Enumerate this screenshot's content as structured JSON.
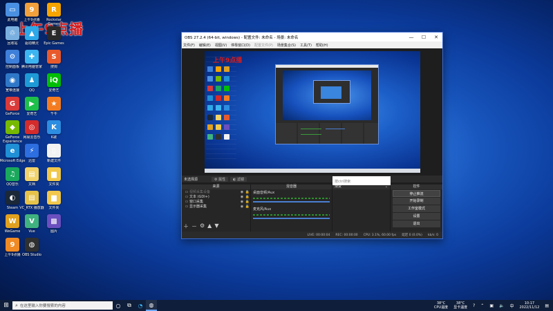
{
  "desktop": {
    "watermark": "上午9点播",
    "icons": [
      {
        "label": "此电脑",
        "color": "#4a90e2",
        "glyph": "▭"
      },
      {
        "label": "回收站",
        "color": "#7ab0e0",
        "glyph": "♲"
      },
      {
        "label": "控制面板",
        "color": "#3d7fd9",
        "glyph": "⚙"
      },
      {
        "label": "宽带连接",
        "color": "#2f78c8",
        "glyph": "◉"
      },
      {
        "label": "GeForce",
        "color": "#d93a3a",
        "glyph": "G"
      },
      {
        "label": "GeForce Experience",
        "color": "#76b900",
        "glyph": "◆"
      },
      {
        "label": "Microsoft Edge",
        "color": "#1f8fd6",
        "glyph": "e"
      },
      {
        "label": "QQ音乐",
        "color": "#19a85c",
        "glyph": "♫"
      },
      {
        "label": "Steam",
        "color": "#1b2838",
        "glyph": "◐"
      },
      {
        "label": "WeGame",
        "color": "#e0a020",
        "glyph": "W"
      },
      {
        "label": "上午9点播",
        "color": "#f08a24",
        "glyph": "9"
      },
      {
        "label": "上午9点播",
        "color": "#f2a03c",
        "glyph": "9"
      },
      {
        "label": "驱动精灵",
        "color": "#2da8e8",
        "glyph": "▲"
      },
      {
        "label": "腾讯电脑管家",
        "color": "#3cb4f0",
        "glyph": "✚"
      },
      {
        "label": "QQ",
        "color": "#1e9ad6",
        "glyph": "♟"
      },
      {
        "label": "爱奇艺",
        "color": "#1ec04a",
        "glyph": "▶"
      },
      {
        "label": "网易云音乐",
        "color": "#d42b2b",
        "glyph": "◎"
      },
      {
        "label": "迅雷",
        "color": "#2d6ee0",
        "glyph": "⚡"
      },
      {
        "label": "文档",
        "color": "#f1d36a",
        "glyph": "▤"
      },
      {
        "label": "VC_RTX 播放器",
        "color": "#e6c24a",
        "glyph": "▤"
      },
      {
        "label": "Vue",
        "color": "#3fb27f",
        "glyph": "V"
      },
      {
        "label": "OBS Studio",
        "color": "#303030",
        "glyph": "◍"
      },
      {
        "label": "Rockstar Games",
        "color": "#f5a400",
        "glyph": "R"
      },
      {
        "label": "Epic Games",
        "color": "#2a2a2a",
        "glyph": "E"
      },
      {
        "label": "搜狗",
        "color": "#e85a2c",
        "glyph": "S"
      },
      {
        "label": "爱奇艺",
        "color": "#00be06",
        "glyph": "iQ"
      },
      {
        "label": "千牛",
        "color": "#f47c20",
        "glyph": "★"
      },
      {
        "label": "K歌",
        "color": "#2d8de0",
        "glyph": "K"
      },
      {
        "label": "新建文件",
        "color": "#f2f2f2",
        "glyph": "▯"
      },
      {
        "label": "文件夹",
        "color": "#f1c84b",
        "glyph": "▆"
      },
      {
        "label": "文件夹",
        "color": "#f1c84b",
        "glyph": "▆"
      },
      {
        "label": "图片",
        "color": "#6a4fbf",
        "glyph": "▩"
      }
    ]
  },
  "obs": {
    "title": "OBS 27.2.4 (64-bit, windows) - 配置文件: 未命名 - 场景: 未命名",
    "menu": [
      "文件(F)",
      "编辑(E)",
      "视图(V)",
      "停靠窗口(D)",
      "配置文件(P)",
      "场景集合(S)",
      "工具(T)",
      "帮助(H)"
    ],
    "scene_label": "未选择源",
    "scene_buttons": [
      "属性",
      "滤镜"
    ],
    "filter_placeholder": "按ctrl搜索",
    "docks": {
      "sources_header": "来源",
      "mixer_header": "混音器",
      "transitions_header": "转场",
      "controls_header": "控件"
    },
    "sources": [
      {
        "name": "视频采集设备",
        "dim": true
      },
      {
        "name": "文本 (GDI+)",
        "dim": false
      },
      {
        "name": "窗口采集",
        "dim": false
      },
      {
        "name": "显示器采集",
        "dim": false
      }
    ],
    "mixer_tracks": [
      {
        "name": "桌面音频/Aux"
      },
      {
        "name": "麦克风/Aux"
      }
    ],
    "transition": "渐变",
    "controls": [
      "停止推流",
      "开始录制",
      "工作室模式",
      "设置",
      "退出"
    ],
    "status": {
      "live": "LIVE: 00:00:04",
      "rec": "REC: 00:00:00",
      "cpu": "CPU: 3.1%, 60.00 fps",
      "dropped": "延迟 0 (0.0%)",
      "bitrate": "kb/s: 0"
    }
  },
  "taskbar": {
    "search_placeholder": "在这里输入你要搜索的内容",
    "weather_temp": "38°C",
    "weather_label": "CPU温度",
    "gpu_temp": "38°C",
    "gpu_label": "显卡温度",
    "time": "10:17",
    "date": "2022/11/12",
    "ime": "中"
  },
  "colors": {
    "watermark": "#d81b1b",
    "taskbar": "#0f1e3a",
    "obs_bg": "#2b2b2b",
    "meter": "#2f8f2f"
  }
}
